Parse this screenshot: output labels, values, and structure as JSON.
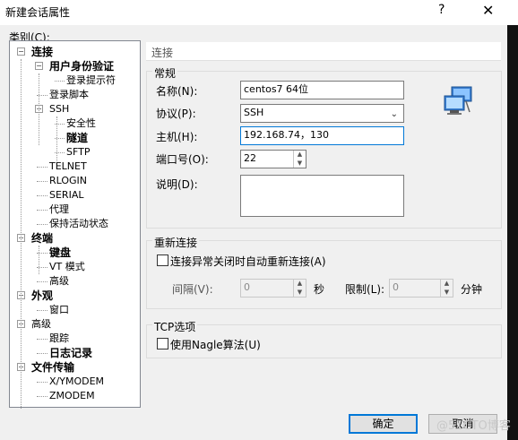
{
  "window": {
    "title": "新建会话属性",
    "help": "?",
    "close": "✕"
  },
  "category_label": "类别(C):",
  "tree": [
    {
      "label": "连接",
      "bold": true,
      "exp": "minus"
    },
    {
      "label": "用户身份验证",
      "bold": true,
      "exp": "minus"
    },
    {
      "label": "登录提示符",
      "bold": false
    },
    {
      "label": "登录脚本",
      "bold": false
    },
    {
      "label": "SSH",
      "bold": false,
      "exp": "minus"
    },
    {
      "label": "安全性",
      "bold": false
    },
    {
      "label": "隧道",
      "bold": true
    },
    {
      "label": "SFTP",
      "bold": false
    },
    {
      "label": "TELNET",
      "bold": false
    },
    {
      "label": "RLOGIN",
      "bold": false
    },
    {
      "label": "SERIAL",
      "bold": false
    },
    {
      "label": "代理",
      "bold": false
    },
    {
      "label": "保持活动状态",
      "bold": false
    },
    {
      "label": "终端",
      "bold": true,
      "exp": "minus"
    },
    {
      "label": "键盘",
      "bold": true
    },
    {
      "label": "VT 模式",
      "bold": false
    },
    {
      "label": "高级",
      "bold": false
    },
    {
      "label": "外观",
      "bold": true,
      "exp": "minus"
    },
    {
      "label": "窗口",
      "bold": false
    },
    {
      "label": "高级",
      "bold": false,
      "exp": "minus"
    },
    {
      "label": "跟踪",
      "bold": false
    },
    {
      "label": "日志记录",
      "bold": true
    },
    {
      "label": "文件传输",
      "bold": true,
      "exp": "minus"
    },
    {
      "label": "X/YMODEM",
      "bold": false
    },
    {
      "label": "ZMODEM",
      "bold": false
    }
  ],
  "panel": {
    "header": "连接",
    "general": {
      "title": "常规",
      "name_label": "名称(N):",
      "name_value": "centos7 64位",
      "protocol_label": "协议(P):",
      "protocol_value": "SSH",
      "host_label": "主机(H):",
      "host_value": "192.168.74，130",
      "port_label": "端口号(O):",
      "port_value": "22",
      "desc_label": "说明(D):",
      "desc_value": ""
    },
    "reconnect": {
      "title": "重新连接",
      "auto_label": "连接异常关闭时自动重新连接(A)",
      "interval_label": "间隔(V):",
      "interval_value": "0",
      "interval_unit": "秒",
      "limit_label": "限制(L):",
      "limit_value": "0",
      "limit_unit": "分钟"
    },
    "tcp": {
      "title": "TCP选项",
      "nagle_label": "使用Nagle算法(U)"
    }
  },
  "buttons": {
    "ok": "确定",
    "cancel": "取消"
  },
  "watermark": "@51CTO博客",
  "icons": {
    "network": "network-computers-icon"
  }
}
